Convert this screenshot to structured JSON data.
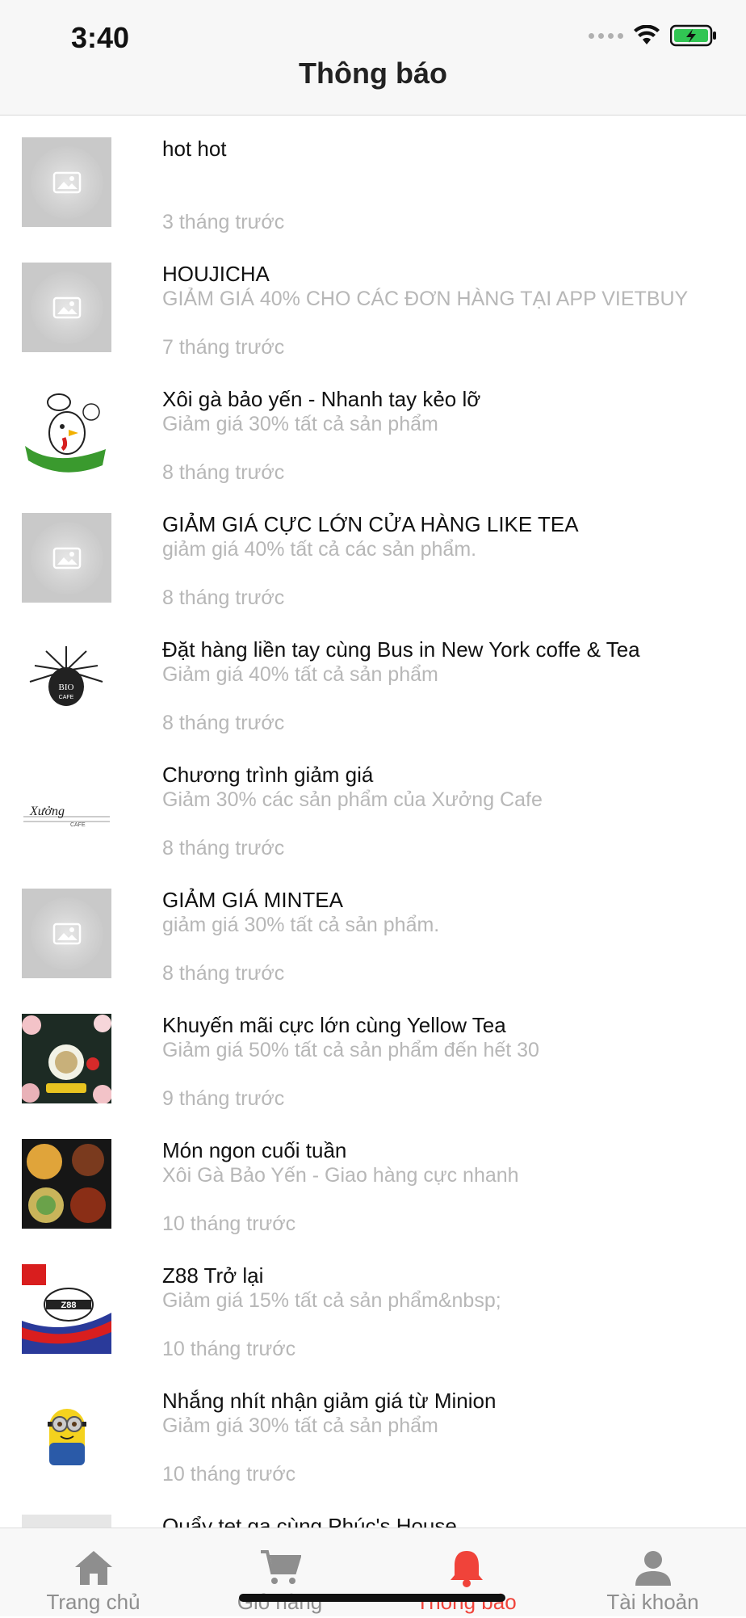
{
  "status_bar": {
    "time": "3:40"
  },
  "header": {
    "title": "Thông báo"
  },
  "notifications": [
    {
      "title": "hot hot",
      "subtitle": "",
      "time": "3 tháng trước",
      "thumb": "placeholder"
    },
    {
      "title": "HOUJICHA",
      "subtitle": "GIẢM GIÁ 40% CHO CÁC ĐƠN HÀNG TẠI APP VIETBUY",
      "time": "7 tháng trước",
      "thumb": "placeholder"
    },
    {
      "title": "Xôi gà bảo yến - Nhanh tay kẻo lỡ",
      "subtitle": "Giảm giá 30% tất cả sản phẩm",
      "time": "8 tháng trước",
      "thumb": "chicken-logo"
    },
    {
      "title": "GIẢM GIÁ CỰC LỚN CỬA HÀNG LIKE TEA",
      "subtitle": "giảm giá 40% tất cả các sản phẩm.",
      "time": "8 tháng trước",
      "thumb": "placeholder"
    },
    {
      "title": "Đặt hàng liền tay cùng Bus in New York coffe & Tea",
      "subtitle": "Giảm giá 40% tất cả sản phẩm",
      "time": "8 tháng trước",
      "thumb": "statue-logo"
    },
    {
      "title": "Chương trình giảm giá",
      "subtitle": "Giảm 30% các sản phẩm của Xưởng Cafe",
      "time": "8 tháng trước",
      "thumb": "xuong-logo"
    },
    {
      "title": "GIẢM GIÁ MINTEA",
      "subtitle": "giảm giá 30% tất cả sản phẩm.",
      "time": "8 tháng trước",
      "thumb": "placeholder"
    },
    {
      "title": "Khuyến mãi cực lớn cùng Yellow Tea",
      "subtitle": "Giảm giá 50% tất cả sản phẩm đến hết 30",
      "time": "9 tháng trước",
      "thumb": "yellow-tea-banner"
    },
    {
      "title": "Món ngon cuối tuần",
      "subtitle": "Xôi Gà Bảo Yến - Giao hàng cực nhanh",
      "time": "10 tháng trước",
      "thumb": "food-photo"
    },
    {
      "title": "Z88 Trở lại",
      "subtitle": "Giảm giá 15% tất cả sản phẩm&nbsp;",
      "time": "10 tháng trước",
      "thumb": "z88-banner"
    },
    {
      "title": "Nhắng nhít nhận giảm giá từ Minion",
      "subtitle": "Giảm giá 30% tất cả sản phẩm",
      "time": "10 tháng trước",
      "thumb": "minion"
    },
    {
      "title": "Quẩy tẹt ga cùng Phúc's House",
      "subtitle": "",
      "time": "",
      "thumb": "green-logo"
    }
  ],
  "tabbar": {
    "tabs": [
      {
        "label": "Trang chủ",
        "icon": "home-icon"
      },
      {
        "label": "Giỏ hàng",
        "icon": "cart-icon"
      },
      {
        "label": "Thông báo",
        "icon": "bell-icon",
        "active": true
      },
      {
        "label": "Tài khoản",
        "icon": "user-icon"
      }
    ]
  },
  "colors": {
    "accent": "#f0433a",
    "muted": "#b7b7b7",
    "placeholder": "#c9c9c9"
  }
}
